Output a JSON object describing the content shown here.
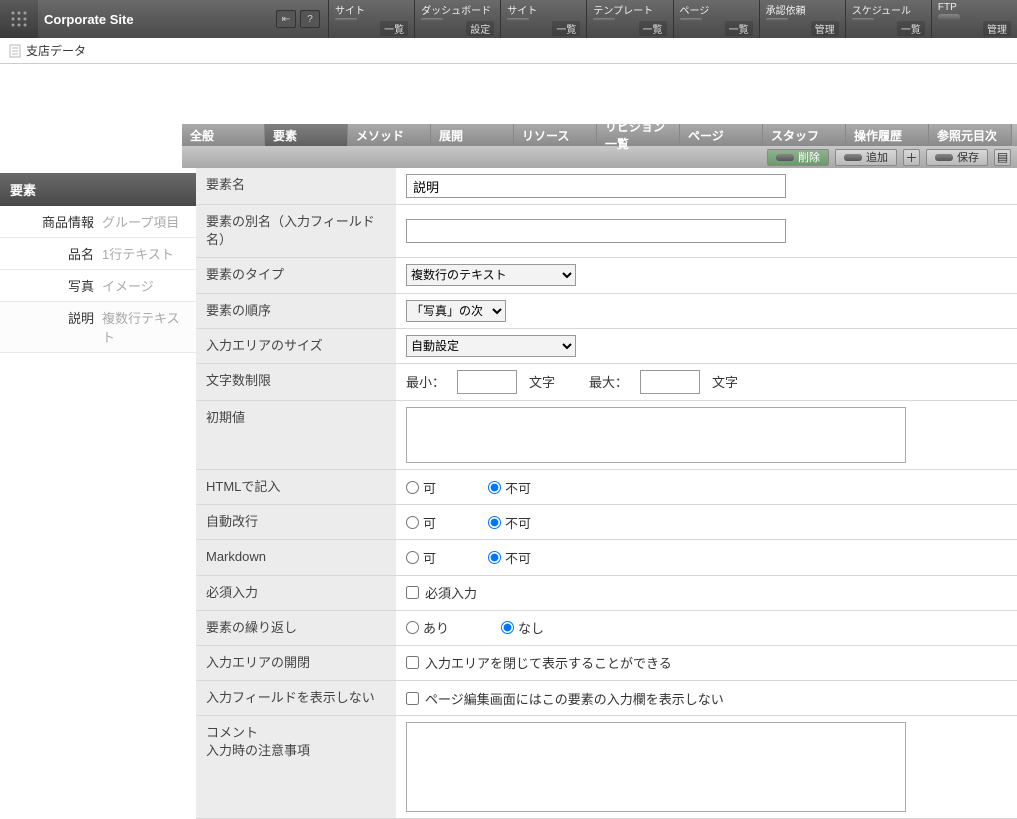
{
  "topbar": {
    "title": "Corporate Site",
    "nav": [
      {
        "top": "サイト",
        "bot": "一覧"
      },
      {
        "top": "ダッシュボード",
        "bot": "設定"
      },
      {
        "top": "サイト",
        "bot": "一覧"
      },
      {
        "top": "テンプレート",
        "bot": "一覧"
      },
      {
        "top": "ページ",
        "bot": "一覧"
      },
      {
        "top": "承認依頼",
        "bot": "管理"
      },
      {
        "top": "スケジュール",
        "bot": "一覧"
      },
      {
        "top": "FTP",
        "bot": "管理"
      }
    ]
  },
  "subhead": {
    "title": "支店データ"
  },
  "sidebar": {
    "header": "要素",
    "rows": [
      {
        "name": "商品情報",
        "type": "グループ項目"
      },
      {
        "name": "品名",
        "type": "1行テキスト"
      },
      {
        "name": "写真",
        "type": "イメージ"
      },
      {
        "name": "説明",
        "type": "複数行テキスト",
        "active": true
      }
    ]
  },
  "tabs": [
    "全般",
    "要素",
    "メソッド",
    "展開",
    "リソース",
    "リビジョン一覧",
    "ページ",
    "スタッフ",
    "操作履歴",
    "参照元目次"
  ],
  "active_tab_index": 1,
  "actions": {
    "delete": "削除",
    "add": "追加",
    "save": "保存"
  },
  "form": {
    "name": {
      "label": "要素名",
      "value": "説明"
    },
    "alias": {
      "label": "要素の別名（入力フィールド名）",
      "value": ""
    },
    "type": {
      "label": "要素のタイプ",
      "value": "複数行のテキスト"
    },
    "order": {
      "label": "要素の順序",
      "value": "「写真」の次"
    },
    "size": {
      "label": "入力エリアのサイズ",
      "value": "自動設定"
    },
    "chars": {
      "label": "文字数制限",
      "min_pre": "最小：",
      "min_post": "文字",
      "max_pre": "最大：",
      "max_post": "文字"
    },
    "default": {
      "label": "初期値"
    },
    "html": {
      "label": "HTMLで記入",
      "yes": "可",
      "no": "不可",
      "value": "no"
    },
    "autobreak": {
      "label": "自動改行",
      "yes": "可",
      "no": "不可",
      "value": "no"
    },
    "markdown": {
      "label": "Markdown",
      "yes": "可",
      "no": "不可",
      "value": "no"
    },
    "required": {
      "label": "必須入力",
      "opt": "必須入力"
    },
    "repeat": {
      "label": "要素の繰り返し",
      "yes": "あり",
      "no": "なし",
      "value": "no"
    },
    "collapse": {
      "label": "入力エリアの開閉",
      "opt": "入力エリアを閉じて表示することができる"
    },
    "hide": {
      "label": "入力フィールドを表示しない",
      "opt": "ページ編集画面にはこの要素の入力欄を表示しない"
    },
    "comment": {
      "label1": "コメント",
      "label2": "入力時の注意事項"
    }
  }
}
